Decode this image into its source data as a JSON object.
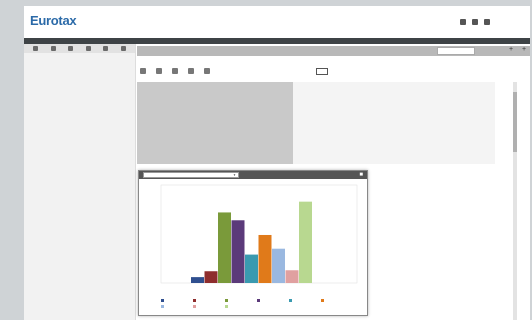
{
  "app": {
    "logo": "Eurotax",
    "logo_sub": "",
    "header_user": "",
    "strip_title": ""
  },
  "left_panel": {
    "toolbar_icons": [
      "settings-icon",
      "home-icon",
      "list-icon",
      "table-icon",
      "download-icon",
      "gear-icon"
    ],
    "sections": [],
    "fields": [],
    "radios": [],
    "bottom_rows": []
  },
  "tabs": [],
  "tab_input_placeholder": "",
  "path_text": "",
  "toolbar2": [],
  "export_label": "",
  "table": {
    "rows": [
      {
        "label": "",
        "value": ""
      },
      {
        "label": "",
        "value": ""
      },
      {
        "label": "",
        "value": ""
      },
      {
        "label": "",
        "value": ""
      },
      {
        "label": "",
        "value": ""
      },
      {
        "label": "",
        "value": ""
      },
      {
        "label": "",
        "value": ""
      },
      {
        "label": "",
        "value": ""
      },
      {
        "label": "",
        "value": ""
      },
      {
        "label": "",
        "value": ""
      },
      {
        "label": "",
        "value": ""
      },
      {
        "label": "",
        "value": ""
      },
      {
        "label": "",
        "value": ""
      },
      {
        "label": "",
        "value": ""
      }
    ]
  },
  "chart_window": {
    "select_value": ""
  },
  "chart_data": {
    "type": "bar",
    "title": "",
    "xlabel": "",
    "ylabel": "",
    "ylim": [
      0,
      10
    ],
    "y_ticks": [],
    "categories": [
      ""
    ],
    "series": [
      {
        "name": "",
        "color": "#2f4f8f",
        "values": [
          0.6
        ]
      },
      {
        "name": "",
        "color": "#8e2d2d",
        "values": [
          1.2
        ]
      },
      {
        "name": "",
        "color": "#7a9a3a",
        "values": [
          7.2
        ]
      },
      {
        "name": "",
        "color": "#5b3a7a",
        "values": [
          6.4
        ]
      },
      {
        "name": "",
        "color": "#3a9ab0",
        "values": [
          2.9
        ]
      },
      {
        "name": "",
        "color": "#e07a1a",
        "values": [
          4.9
        ]
      },
      {
        "name": "",
        "color": "#9ab8e0",
        "values": [
          3.5
        ]
      },
      {
        "name": "",
        "color": "#e0a0a0",
        "values": [
          1.3
        ]
      },
      {
        "name": "",
        "color": "#b8d890",
        "values": [
          8.3
        ]
      }
    ]
  }
}
